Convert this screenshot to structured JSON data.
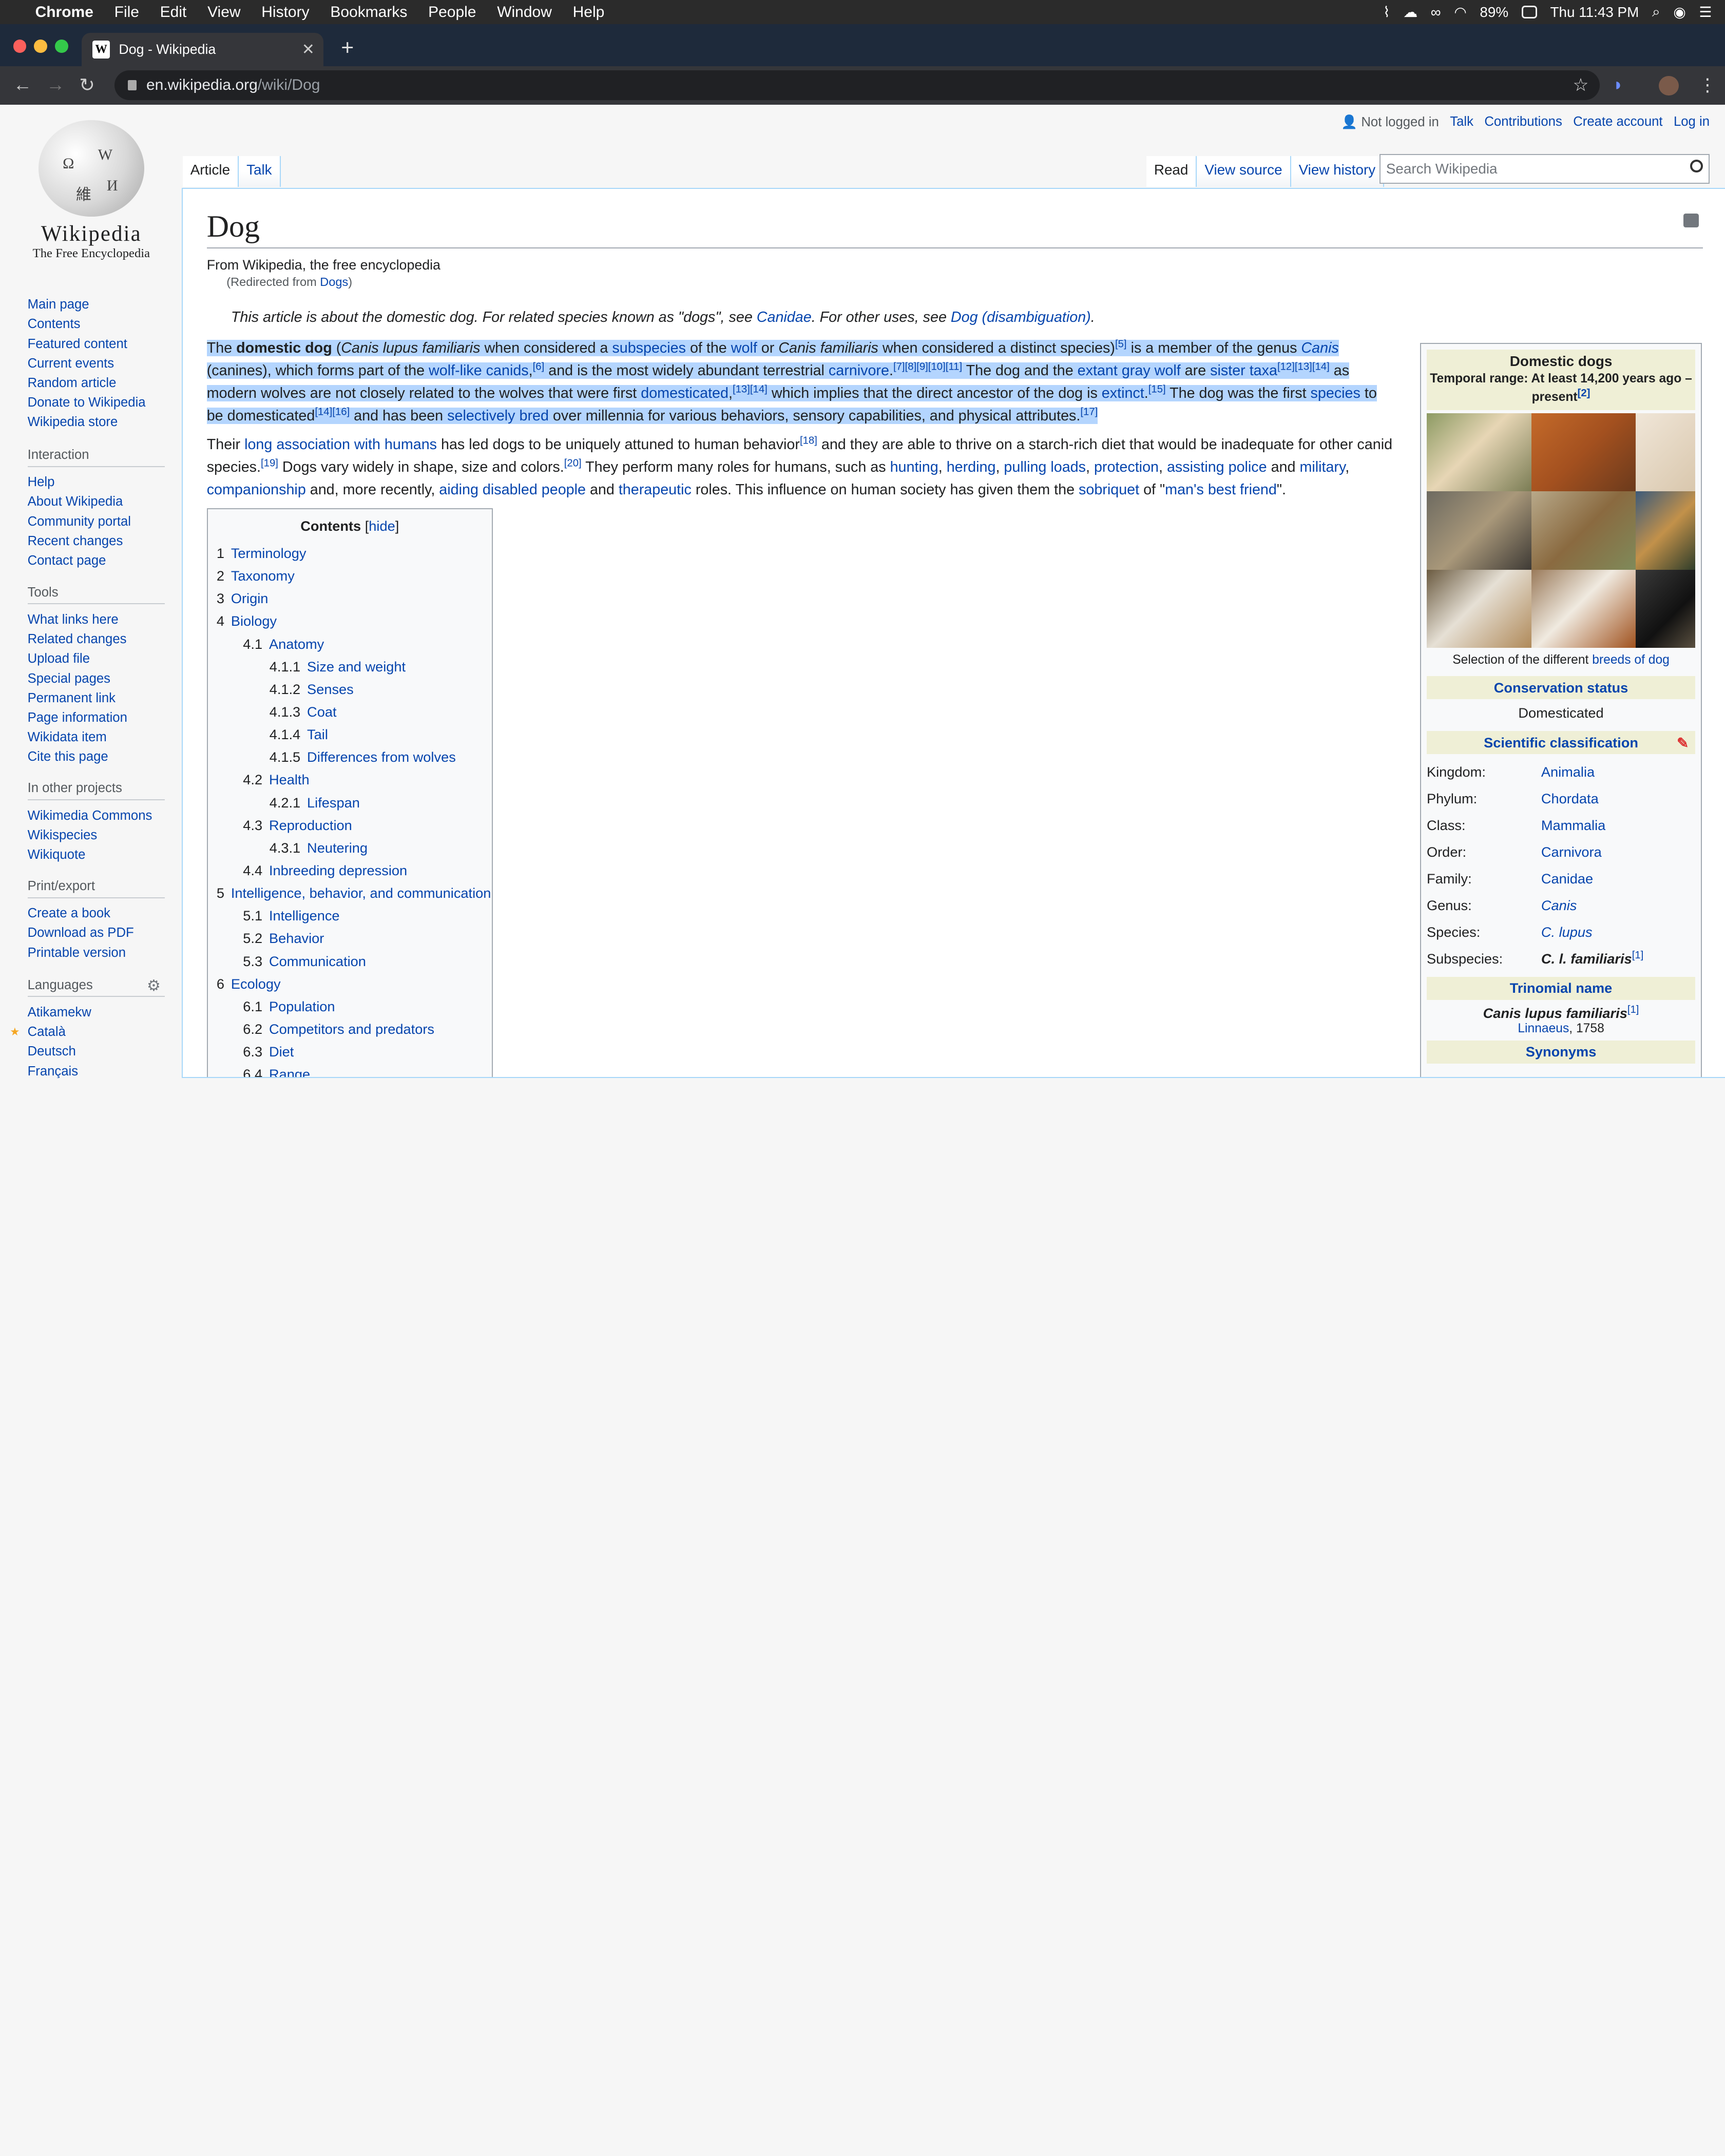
{
  "menubar": {
    "app": "Chrome",
    "items": [
      "File",
      "Edit",
      "View",
      "History",
      "Bookmarks",
      "People",
      "Window",
      "Help"
    ],
    "battery": "89%",
    "clock": "Thu 11:43 PM"
  },
  "browser": {
    "tab_title": "Dog - Wikipedia",
    "url_host": "en.wikipedia.org",
    "url_path": "/wiki/Dog"
  },
  "wiki": {
    "logo_word": "Wikipedia",
    "logo_tagline": "The Free Encyclopedia",
    "nav_main": [
      "Main page",
      "Contents",
      "Featured content",
      "Current events",
      "Random article",
      "Donate to Wikipedia",
      "Wikipedia store"
    ],
    "interaction_title": "Interaction",
    "interaction": [
      "Help",
      "About Wikipedia",
      "Community portal",
      "Recent changes",
      "Contact page"
    ],
    "tools_title": "Tools",
    "tools": [
      "What links here",
      "Related changes",
      "Upload file",
      "Special pages",
      "Permanent link",
      "Page information",
      "Wikidata item",
      "Cite this page"
    ],
    "projects_title": "In other projects",
    "projects": [
      "Wikimedia Commons",
      "Wikispecies",
      "Wikiquote"
    ],
    "print_title": "Print/export",
    "print": [
      "Create a book",
      "Download as PDF",
      "Printable version"
    ],
    "languages_title": "Languages",
    "languages": [
      "Atikamekw",
      "Català",
      "Deutsch",
      "Français"
    ],
    "personal": {
      "status": "Not logged in",
      "talk": "Talk",
      "contributions": "Contributions",
      "create": "Create account",
      "login": "Log in"
    },
    "tabs": {
      "article": "Article",
      "talk": "Talk",
      "read": "Read",
      "view_source": "View source",
      "view_history": "View history"
    },
    "search_placeholder": "Search Wikipedia"
  },
  "article": {
    "title": "Dog",
    "from": "From Wikipedia, the free encyclopedia",
    "redirect_prefix": "(Redirected from ",
    "redirect_link": "Dogs",
    "redirect_suffix": ")",
    "hatnote": "This article is about the domestic dog. For related species known as \"dogs\", see Canidae. For other uses, see Dog (disambiguation)."
  },
  "toc": {
    "title": "Contents",
    "hide": "hide",
    "items": [
      {
        "n": "1",
        "t": "Terminology",
        "lvl": 0
      },
      {
        "n": "2",
        "t": "Taxonomy",
        "lvl": 0
      },
      {
        "n": "3",
        "t": "Origin",
        "lvl": 0
      },
      {
        "n": "4",
        "t": "Biology",
        "lvl": 0
      },
      {
        "n": "4.1",
        "t": "Anatomy",
        "lvl": 1
      },
      {
        "n": "4.1.1",
        "t": "Size and weight",
        "lvl": 2
      },
      {
        "n": "4.1.2",
        "t": "Senses",
        "lvl": 2
      },
      {
        "n": "4.1.3",
        "t": "Coat",
        "lvl": 2
      },
      {
        "n": "4.1.4",
        "t": "Tail",
        "lvl": 2
      },
      {
        "n": "4.1.5",
        "t": "Differences from wolves",
        "lvl": 2
      },
      {
        "n": "4.2",
        "t": "Health",
        "lvl": 1
      },
      {
        "n": "4.2.1",
        "t": "Lifespan",
        "lvl": 2
      },
      {
        "n": "4.3",
        "t": "Reproduction",
        "lvl": 1
      },
      {
        "n": "4.3.1",
        "t": "Neutering",
        "lvl": 2
      },
      {
        "n": "4.4",
        "t": "Inbreeding depression",
        "lvl": 1
      },
      {
        "n": "5",
        "t": "Intelligence, behavior, and communication",
        "lvl": 0
      },
      {
        "n": "5.1",
        "t": "Intelligence",
        "lvl": 1
      },
      {
        "n": "5.2",
        "t": "Behavior",
        "lvl": 1
      },
      {
        "n": "5.3",
        "t": "Communication",
        "lvl": 1
      },
      {
        "n": "6",
        "t": "Ecology",
        "lvl": 0
      },
      {
        "n": "6.1",
        "t": "Population",
        "lvl": 1
      },
      {
        "n": "6.2",
        "t": "Competitors and predators",
        "lvl": 1
      },
      {
        "n": "6.3",
        "t": "Diet",
        "lvl": 1
      },
      {
        "n": "6.4",
        "t": "Range",
        "lvl": 1
      }
    ]
  },
  "infobox": {
    "title": "Domestic dogs",
    "range": "Temporal range: At least 14,200 years ago – present",
    "range_ref": "[2]",
    "caption_prefix": "Selection of the different ",
    "caption_link": "breeds of dog",
    "conservation_title": "Conservation status",
    "conservation_value": "Domesticated",
    "classification_title": "Scientific classification",
    "classification": [
      {
        "k": "Kingdom:",
        "v": "Animalia"
      },
      {
        "k": "Phylum:",
        "v": "Chordata"
      },
      {
        "k": "Class:",
        "v": "Mammalia"
      },
      {
        "k": "Order:",
        "v": "Carnivora"
      },
      {
        "k": "Family:",
        "v": "Canidae"
      },
      {
        "k": "Genus:",
        "v": "Canis"
      },
      {
        "k": "Species:",
        "v": "C. lupus"
      },
      {
        "k": "Subspecies:",
        "v": "C. l. familiaris"
      }
    ],
    "subspecies_ref": "[1]",
    "trinomial_title": "Trinomial name",
    "trinomial_value": "Canis lupus familiaris",
    "trinomial_ref": "[1]",
    "authority": "Linnaeus",
    "authority_year": ", 1758",
    "synonyms_title": "Synonyms"
  }
}
